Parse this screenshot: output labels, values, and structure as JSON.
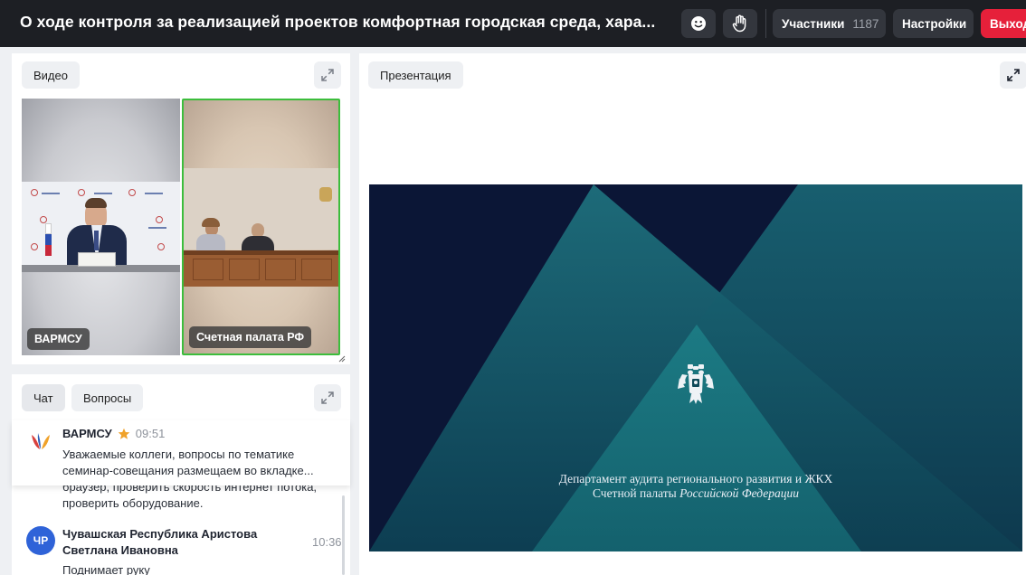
{
  "header": {
    "title": "О ходе контроля за реализацией проектов комфортная городская среда, хара...",
    "participants_label": "Участники",
    "participants_count": "1187",
    "settings_label": "Настройки",
    "exit_label": "Выход",
    "icons": [
      "emoji-icon",
      "raise-hand-icon"
    ]
  },
  "video_panel": {
    "tab_label": "Видео",
    "tiles": [
      {
        "label": "ВАРМСУ",
        "active": false
      },
      {
        "label": "Счетная палата РФ",
        "active": true
      }
    ]
  },
  "presentation": {
    "tab_label": "Презентация",
    "slide_line1": "Департамент аудита регионального развития и ЖКХ",
    "slide_line2_plain": "Счетной палаты ",
    "slide_line2_italic": "Российской Федерации"
  },
  "chat": {
    "tabs": [
      "Чат",
      "Вопросы"
    ],
    "pinned": {
      "author": "ВАРМСУ",
      "time": "09:51",
      "text": "Уважаемые коллеги, вопросы по тематике семинар-совещания размещаем во вкладке..."
    },
    "partial_text": "браузер, проверить скорость интернет потока, проверить оборудование.",
    "messages": [
      {
        "avatar": "ЧР",
        "author": "Чувашская Республика Аристова Светлана Ивановна",
        "time": "10:36",
        "text": "Поднимает руку"
      }
    ]
  },
  "colors": {
    "topbar": "#1d1f24",
    "exit": "#e6203a",
    "active_tile_border": "#3cbd3c",
    "star": "#f0a22a",
    "avatar": "#2f63d8"
  }
}
